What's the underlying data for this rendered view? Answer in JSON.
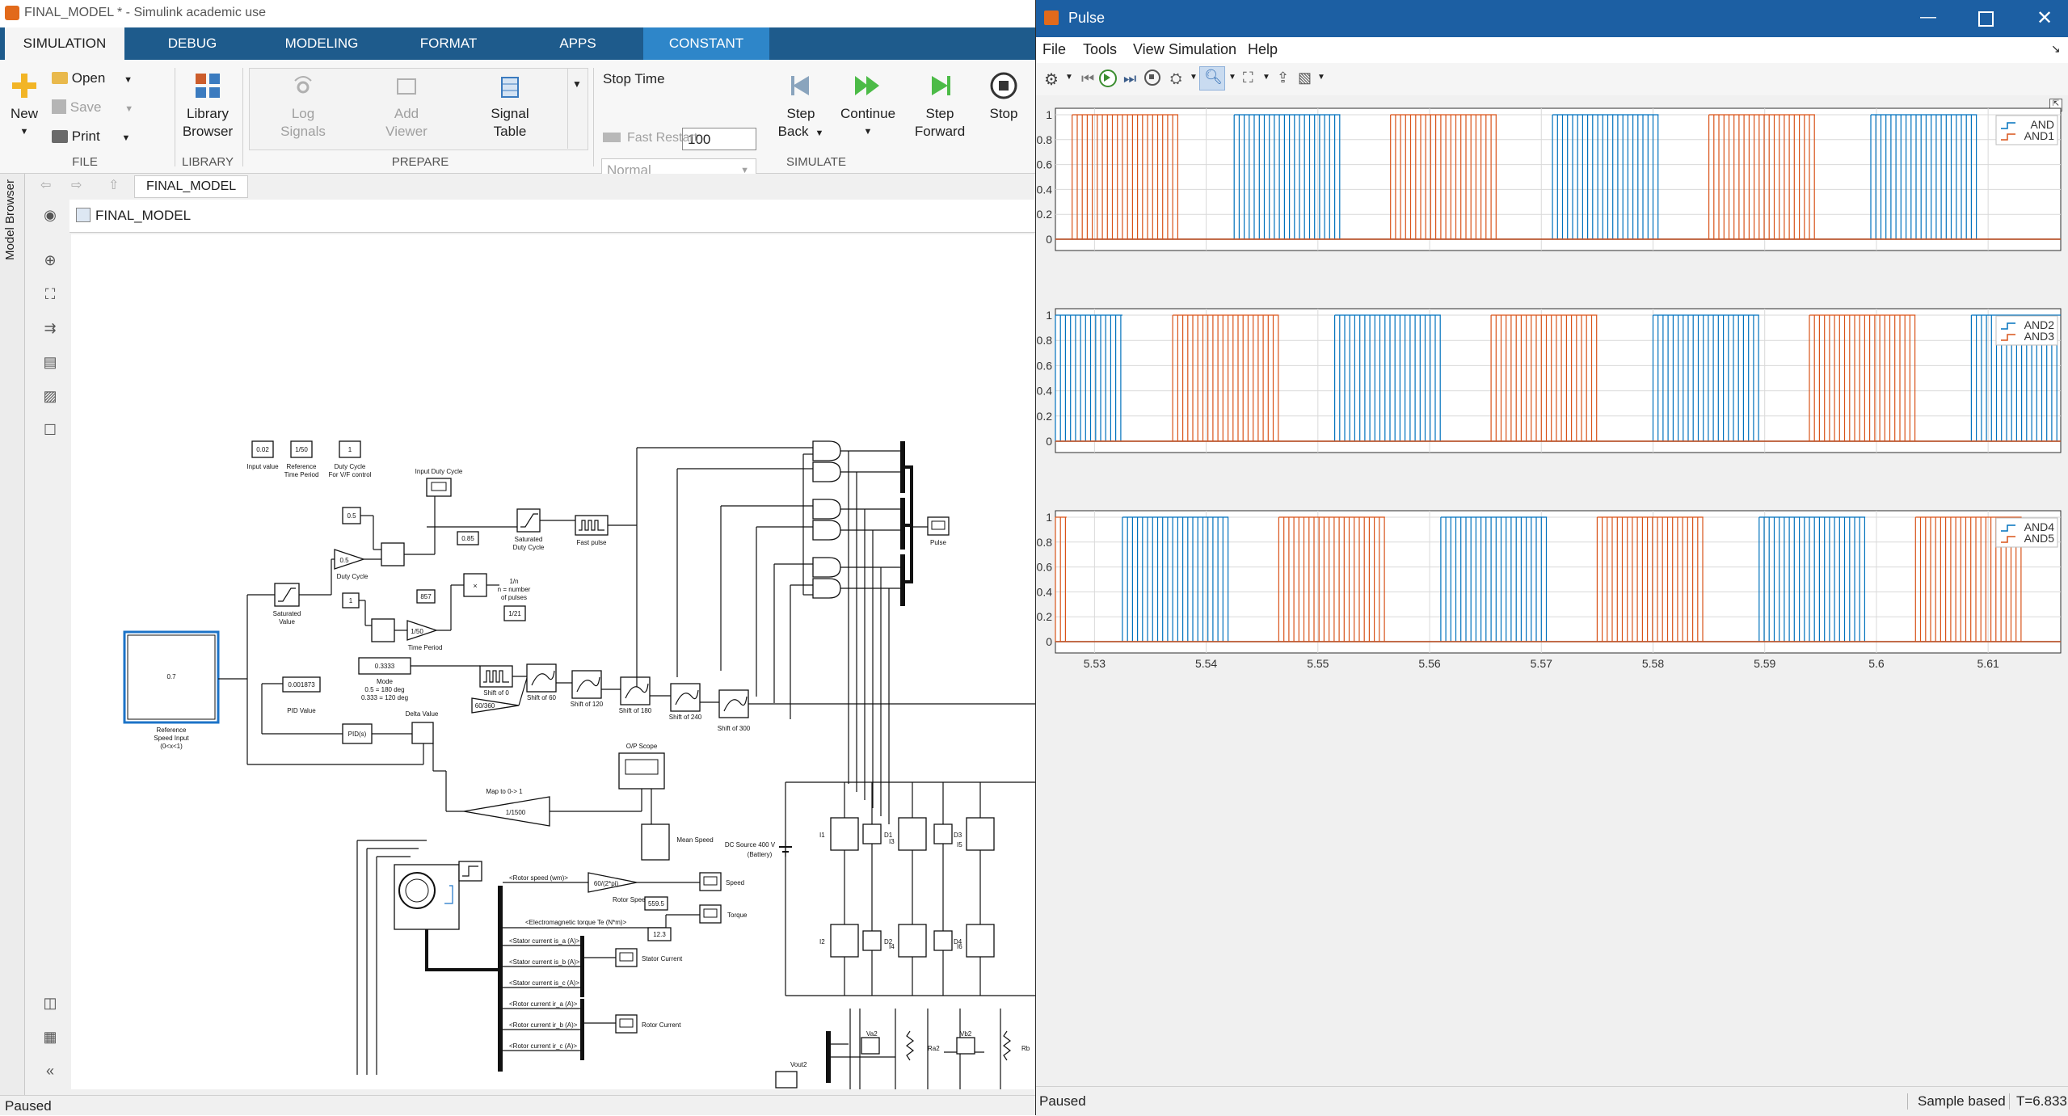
{
  "simulink": {
    "title": "FINAL_MODEL * - Simulink academic use",
    "tabs": [
      "SIMULATION",
      "DEBUG",
      "MODELING",
      "FORMAT",
      "APPS",
      "CONSTANT"
    ],
    "file": {
      "new": "New",
      "open": "Open",
      "save": "Save",
      "print": "Print",
      "group": "FILE"
    },
    "library": {
      "line1": "Library",
      "line2": "Browser",
      "group": "LIBRARY"
    },
    "prepare": {
      "log1": "Log",
      "log2": "Signals",
      "add1": "Add",
      "add2": "Viewer",
      "sig1": "Signal",
      "sig2": "Table",
      "group": "PREPARE"
    },
    "simulate": {
      "stop_time_label": "Stop Time",
      "stop_time_value": "100",
      "mode": "Normal",
      "fast_restart": "Fast Restart",
      "stepback1": "Step",
      "stepback2": "Back",
      "continue": "Continue",
      "stepfwd1": "Step",
      "stepfwd2": "Forward",
      "stop": "Stop",
      "group": "SIMULATE"
    },
    "breadcrumb": "FINAL_MODEL",
    "model_browser": "Model Browser",
    "model_path": "FINAL_MODEL",
    "status": "Paused",
    "diagram": {
      "input_value": "0.02",
      "input_value_label": "Input value",
      "ref_period": "1/50",
      "ref_period_label1": "Reference",
      "ref_period_label2": "Time Period",
      "duty_vf": "1",
      "duty_vf_label1": "Duty Cycle",
      "duty_vf_label2": "For V/F control",
      "input_duty_cycle": "Input Duty Cycle",
      "k05": "0.5",
      "duty_gain": "0.5",
      "duty_cycle": "Duty Cycle",
      "disp_085": "0.85",
      "saturated_duty1": "Saturated",
      "saturated_duty2": "Duty Cycle",
      "fast_pulse": "Fast pulse",
      "disp_857": "857",
      "mult": "×",
      "recip1": "1/n",
      "recip2": "n = number",
      "recip3": "of pulses",
      "disp_121": "1/21",
      "saturated1": "Saturated",
      "saturated2": "Value",
      "k1": "1",
      "tp_gain": "1/50",
      "time_period": "Time Period",
      "mode_const": "0.3333",
      "mode1": "Mode",
      "mode2": "0.5 = 180 deg",
      "mode3": "0.333 = 120 deg",
      "ref_speed": "0.7",
      "ref_speed1": "Reference",
      "ref_speed2": "Speed Input",
      "ref_speed3": "(0<x<1)",
      "pid_disp": "0.001873",
      "pid_value": "PID Value",
      "pid": "PID(s)",
      "delta": "Delta Value",
      "shift0": "Shift of 0",
      "gain60": "60/360",
      "shift60": "Shift of 60",
      "shift120": "Shift of 120",
      "shift180": "Shift of 180",
      "shift240": "Shift of 240",
      "shift300": "Shift of 300",
      "pulse": "Pulse",
      "op_scope": "O/P Scope",
      "map1": "Map to 0-> 1",
      "map2": "1/1500",
      "mean_speed": "Mean Speed",
      "dc1": "DC Source 400 V",
      "dc2": "(Battery)",
      "rotor_speed": "<Rotor speed (wm)>",
      "rpm_gain": "60/(2*pi)",
      "rotor_rpm": "Rotor Speed RPM",
      "rpm_disp": "559.5",
      "speed": "Speed",
      "em_torque": "<Electromagnetic torque Te (N*m)>",
      "torque_disp": "12.3",
      "torque": "Torque",
      "isa": "<Stator current is_a (A)>",
      "isb": "<Stator current is_b (A)>",
      "isc": "<Stator current is_c (A)>",
      "stator_current": "Stator Current",
      "ira": "<Rotor current ir_a (A)>",
      "irb": "<Rotor current ir_b (A)>",
      "irc": "<Rotor current ir_c (A)>",
      "rotor_current": "Rotor Current",
      "i1": "I1",
      "d1": "D1",
      "i3": "I3",
      "d3": "D3",
      "i5": "I5",
      "i2": "I2",
      "d2": "D2",
      "i4": "I4",
      "d4": "D4",
      "i6": "I6",
      "va2": "Va2",
      "ra2": "Ra2",
      "vb2": "Vb2",
      "rb": "Rb",
      "vout2": "Vout2"
    }
  },
  "scope": {
    "title": "Pulse",
    "menu": [
      "File",
      "Tools",
      "View",
      "Simulation",
      "Help"
    ],
    "status_left": "Paused",
    "status_sample": "Sample based",
    "status_time": "T=6.833",
    "colors": {
      "blue": "#0072bd",
      "orange": "#d95319",
      "title": "#1c5fa3"
    },
    "plots": [
      {
        "legend": [
          "AND",
          "AND1"
        ],
        "yticks": [
          "1",
          "0.8",
          "0.6",
          "0.4",
          "0.2",
          "0"
        ]
      },
      {
        "legend": [
          "AND2",
          "AND3"
        ],
        "yticks": [
          "1",
          "0.8",
          "0.6",
          "0.4",
          "0.2",
          "0"
        ]
      },
      {
        "legend": [
          "AND4",
          "AND5"
        ],
        "yticks": [
          "1",
          "0.8",
          "0.6",
          "0.4",
          "0.2",
          "0"
        ]
      }
    ],
    "xticks": [
      "5.53",
      "5.54",
      "5.55",
      "5.56",
      "5.57",
      "5.58",
      "5.59",
      "5.6",
      "5.61"
    ]
  },
  "chart_data": {
    "type": "line",
    "title": "",
    "xlabel": "",
    "ylabel": "",
    "xlim": [
      5.5265,
      5.6165
    ],
    "ylim": [
      0,
      1
    ],
    "legend_placement": "top-right",
    "grid": true,
    "subplots": [
      {
        "series": [
          {
            "name": "AND",
            "color": "#0072bd",
            "high_intervals": [
              [
                5.5425,
                5.552
              ],
              [
                5.571,
                5.5805
              ],
              [
                5.5995,
                5.609
              ]
            ]
          },
          {
            "name": "AND1",
            "color": "#d95319",
            "high_intervals": [
              [
                5.528,
                5.5375
              ],
              [
                5.5565,
                5.566
              ],
              [
                5.585,
                5.5945
              ]
            ]
          }
        ]
      },
      {
        "series": [
          {
            "name": "AND2",
            "color": "#0072bd",
            "high_intervals": [
              [
                5.5265,
                5.5325
              ],
              [
                5.5515,
                5.561
              ],
              [
                5.58,
                5.5895
              ],
              [
                5.6085,
                5.6165
              ]
            ]
          },
          {
            "name": "AND3",
            "color": "#d95319",
            "high_intervals": [
              [
                5.537,
                5.5465
              ],
              [
                5.5655,
                5.575
              ],
              [
                5.594,
                5.6035
              ]
            ]
          }
        ]
      },
      {
        "series": [
          {
            "name": "AND4",
            "color": "#0072bd",
            "high_intervals": [
              [
                5.5325,
                5.542
              ],
              [
                5.561,
                5.5705
              ],
              [
                5.5895,
                5.599
              ]
            ]
          },
          {
            "name": "AND5",
            "color": "#d95319",
            "high_intervals": [
              [
                5.5265,
                5.5275
              ],
              [
                5.5465,
                5.556
              ],
              [
                5.575,
                5.5845
              ],
              [
                5.6035,
                5.613
              ]
            ]
          }
        ]
      }
    ]
  }
}
